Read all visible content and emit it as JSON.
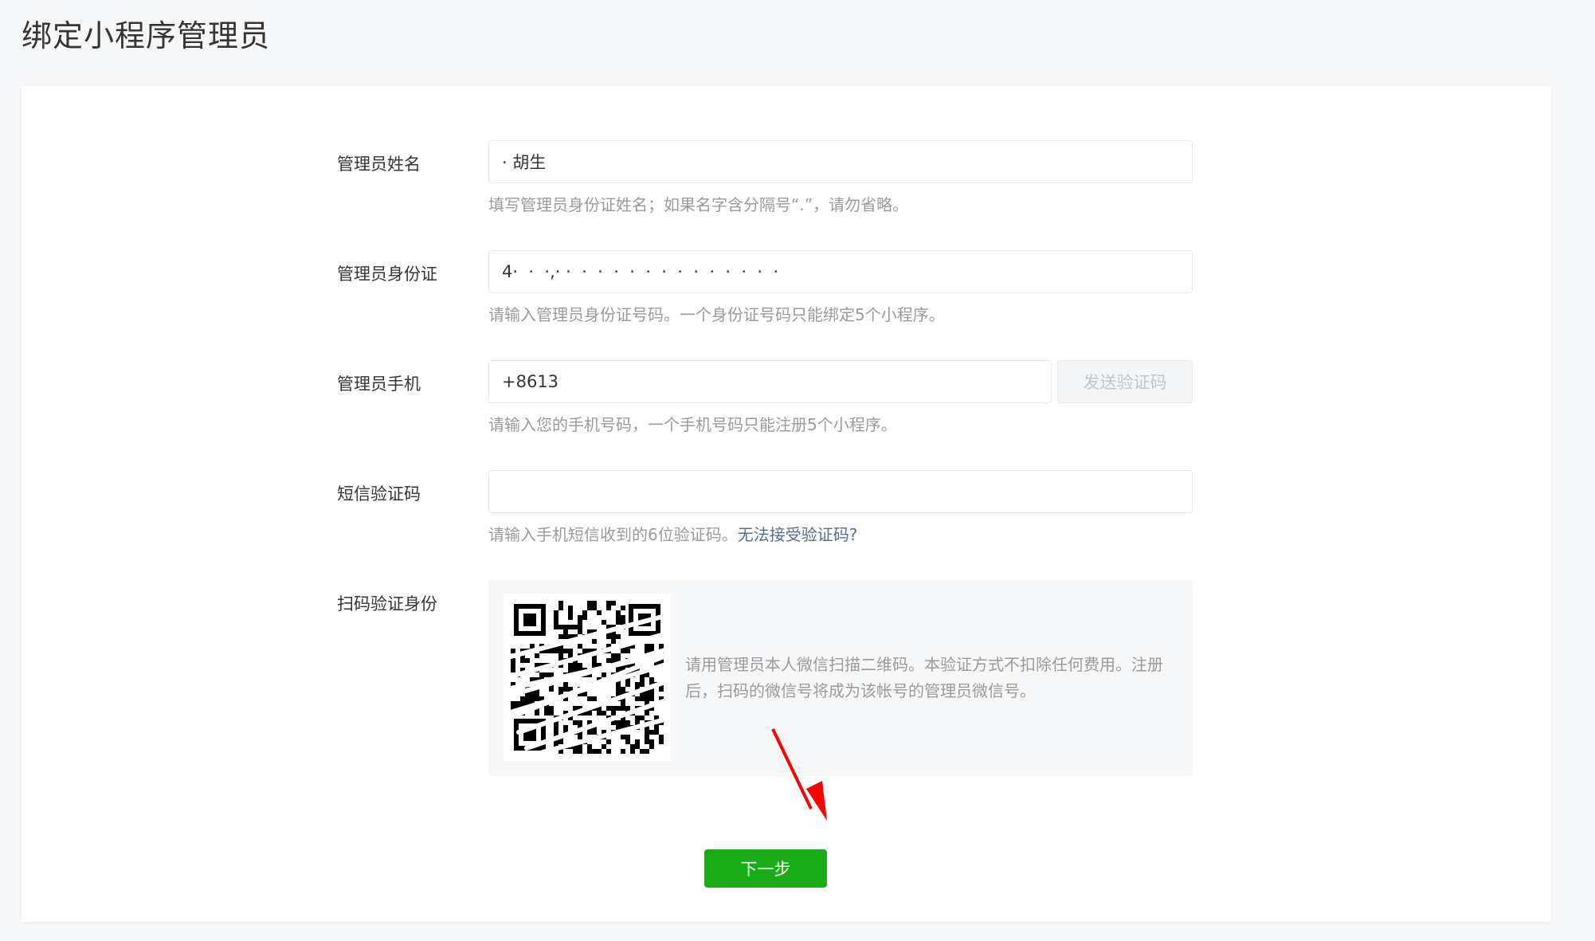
{
  "page": {
    "title": "绑定小程序管理员"
  },
  "form": {
    "name": {
      "label": "管理员姓名",
      "value": "· 胡生",
      "hint": "填写管理员身份证姓名；如果名字含分隔号“.”，请勿省略。"
    },
    "id_card": {
      "label": "管理员身份证",
      "value": "4·  ·  ·,· ·  ·  ·  ·  ·  ·  ·  ·  ·  ·  ·  ·  ·  ·",
      "hint": "请输入管理员身份证号码。一个身份证号码只能绑定5个小程序。"
    },
    "phone": {
      "label": "管理员手机",
      "value": "+8613",
      "send_code_label": "发送验证码",
      "hint": "请输入您的手机号码，一个手机号码只能注册5个小程序。"
    },
    "sms_code": {
      "label": "短信验证码",
      "value": "",
      "hint": "请输入手机短信收到的6位验证码。",
      "hint_link": "无法接受验证码?"
    },
    "qr_verify": {
      "label": "扫码验证身份",
      "description": "请用管理员本人微信扫描二维码。本验证方式不扣除任何费用。注册后，扫码的微信号将成为该帐号的管理员微信号。"
    },
    "next_label": "下一步"
  },
  "colors": {
    "primary_button": "#1aad19",
    "link": "#576b95",
    "annotation_arrow": "#ff0000"
  }
}
